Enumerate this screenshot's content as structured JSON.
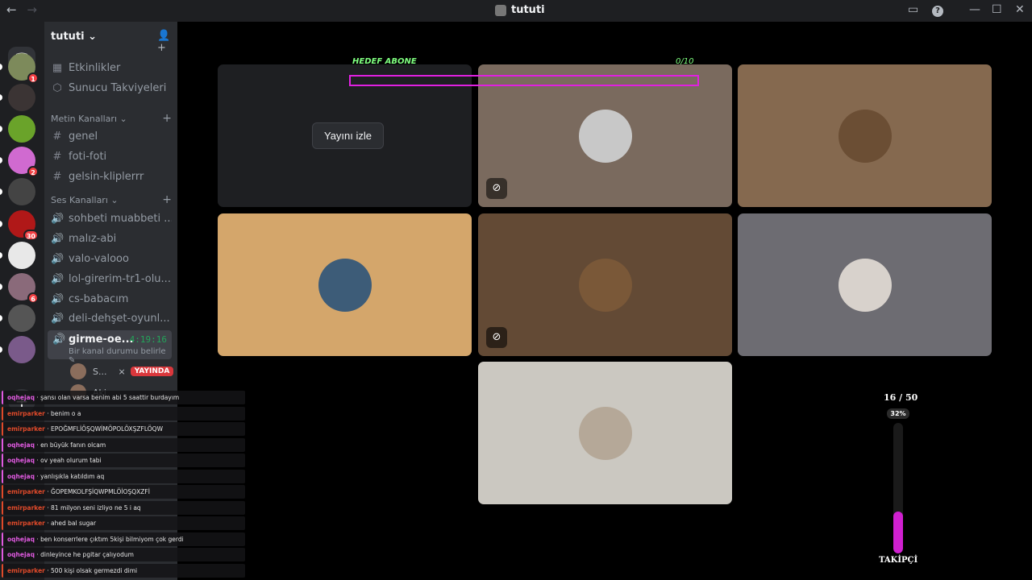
{
  "titlebar": {
    "back": "←",
    "forward": "→",
    "title": "tututi",
    "inbox": "▭",
    "help": "?",
    "minimize": "—",
    "maximize": "☐",
    "close": "✕"
  },
  "colors": {
    "accent": "#e020e0",
    "green": "#7fff7f",
    "live": "#da373c"
  },
  "guilds": {
    "items": [
      {
        "name": "server-1",
        "badge": "1",
        "color": "#7d8a5b"
      },
      {
        "name": "server-2",
        "badge": "",
        "color": "#3b3434"
      },
      {
        "name": "server-3",
        "badge": "",
        "color": "#6aa32a"
      },
      {
        "name": "server-4",
        "badge": "2",
        "color": "#d06ad0"
      },
      {
        "name": "server-5",
        "badge": "",
        "color": "#444"
      },
      {
        "name": "server-6",
        "badge": "30",
        "color": "#b01818"
      },
      {
        "name": "server-7",
        "badge": "",
        "color": "#e8e8e8"
      },
      {
        "name": "server-8",
        "badge": "6",
        "color": "#8a6a7a"
      },
      {
        "name": "server-9",
        "badge": "",
        "color": "#555"
      },
      {
        "name": "server-10",
        "badge": "",
        "color": "#7a5a8a"
      }
    ]
  },
  "sidebar": {
    "server_name": "tututi ⌄",
    "top_items": [
      {
        "icon": "▦",
        "label": "Etkinlikler"
      },
      {
        "icon": "⬡",
        "label": "Sunucu Takviyeleri"
      }
    ],
    "text_category": "Metin Kanalları ⌄",
    "text_channels": [
      "genel",
      "foti-foti",
      "gelsin-kliplerrr"
    ],
    "voice_category": "Ses Kanalları ⌄",
    "voice_channels": [
      "sohbeti muabbeti ...",
      "malız-abi",
      "valo-valooo",
      "lol-girerim-tr1-olu...",
      "cs-babacım",
      "deli-dehşet-oyunl..."
    ],
    "active_channel": {
      "name": "girme-oe...",
      "timer": "4:19:16",
      "status": "Bir kanal durumu belirle ✎"
    },
    "voice_users": [
      {
        "name": "S...",
        "live": "YAYINDA"
      },
      {
        "name": "Aki",
        "live": ""
      }
    ]
  },
  "stage": {
    "hedef_label": "HEDEF ABONE",
    "hedef_count": "0/10",
    "watch_button": "Yayını izle",
    "tiles": [
      {
        "name": "stream",
        "bg": "#1e1f22"
      },
      {
        "name": "user-spiderman",
        "bg": "#7a6a5e",
        "avatar": "#c8c8c8"
      },
      {
        "name": "user-dog",
        "bg": "#85694f",
        "avatar": "#6b4e34"
      },
      {
        "name": "user-man",
        "bg": "#d4a66b",
        "avatar": "#3d5c78"
      },
      {
        "name": "user-cat",
        "bg": "#634a35",
        "avatar": "#7a5838"
      },
      {
        "name": "user-girl",
        "bg": "#6d6c72",
        "avatar": "#d8d2cc"
      },
      {
        "name": "user-woman",
        "bg": "#cbc8c1",
        "avatar": "#b5a898"
      }
    ]
  },
  "follower_widget": {
    "count": "16 / 50",
    "percent": "32%",
    "fill_fraction": 0.32,
    "label": "TAKİPÇİ"
  },
  "chat": [
    {
      "user": "oqhejaq",
      "color": "#e05ae0",
      "text": "şansı olan varsa benim abi 5 saattir burdayım"
    },
    {
      "user": "emirparker",
      "color": "#e04a2a",
      "text": "benim o a"
    },
    {
      "user": "emirparker",
      "color": "#e04a2a",
      "text": "EPOĞMFLİÖŞQWİMÖPOLÖXŞZFLÖQW"
    },
    {
      "user": "oqhejaq",
      "color": "#e05ae0",
      "text": "en büyük fanın olcam"
    },
    {
      "user": "oqhejaq",
      "color": "#e05ae0",
      "text": "ov yeah olurum tabi"
    },
    {
      "user": "oqhejaq",
      "color": "#e05ae0",
      "text": "yanlışıkla katıldım aq"
    },
    {
      "user": "emirparker",
      "color": "#e04a2a",
      "text": "ĞOPEMKOLFŞİQWPMLÖİOŞQXZFİ"
    },
    {
      "user": "emirparker",
      "color": "#e04a2a",
      "text": "81 milyon seni izliyo ne 5 i aq"
    },
    {
      "user": "emirparker",
      "color": "#e04a2a",
      "text": "ahed bal sugar"
    },
    {
      "user": "oqhejaq",
      "color": "#e05ae0",
      "text": "ben konserrlere çıktım 5kişi bilmiyom çok gerdi"
    },
    {
      "user": "oqhejaq",
      "color": "#e05ae0",
      "text": "dinleyince he pgitar çalıyodum"
    },
    {
      "user": "emirparker",
      "color": "#e04a2a",
      "text": "500 kişi olsak germezdi dimi"
    }
  ]
}
